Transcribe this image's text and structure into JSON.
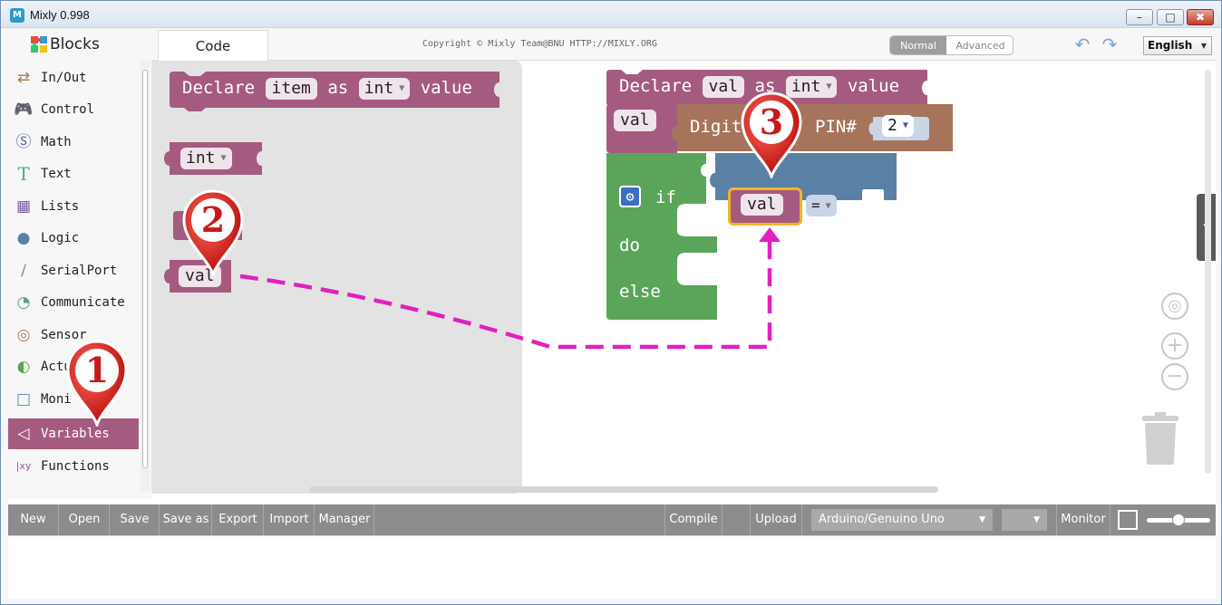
{
  "window": {
    "title": "Mixly 0.998",
    "min_icon": "–",
    "max_icon": "□",
    "close_icon": "✖"
  },
  "tabs": {
    "blocks": "Blocks",
    "code": "Code"
  },
  "copyright": "Copyright © Mixly Team@BNU HTTP://MIXLY.ORG",
  "mode": {
    "normal": "Normal",
    "advanced": "Advanced"
  },
  "language": "English",
  "categories": [
    {
      "label": "In/Out",
      "icon": "arrows-icon",
      "color": "#a0522d"
    },
    {
      "label": "Control",
      "icon": "gamepad-icon",
      "color": "#5ba55b"
    },
    {
      "label": "Math",
      "icon": "math-icon",
      "color": "#5b67a5"
    },
    {
      "label": "Text",
      "icon": "text-icon",
      "color": "#5ba58c"
    },
    {
      "label": "Lists",
      "icon": "lists-icon",
      "color": "#745ba5"
    },
    {
      "label": "Logic",
      "icon": "bulb-icon",
      "color": "#5b80a5"
    },
    {
      "label": "SerialPort",
      "icon": "plug-icon",
      "color": "#7ba05b"
    },
    {
      "label": "Communicate",
      "icon": "satellite-icon",
      "color": "#5b9e8c"
    },
    {
      "label": "Sensor",
      "icon": "sensor-icon",
      "color": "#a5805b"
    },
    {
      "label": "Actu",
      "icon": "actuator-icon",
      "color": "#5ba55b"
    },
    {
      "label": "Moni",
      "icon": "monitor-icon",
      "color": "#5b8ca5"
    },
    {
      "label": "Variables",
      "icon": "variables-icon",
      "color": "#a55b80",
      "selected": true
    },
    {
      "label": "Functions",
      "icon": "functions-icon",
      "color": "#995ba5"
    }
  ],
  "flyout": {
    "declare": {
      "declare": "Declare",
      "name": "item",
      "as": "as",
      "type": "int",
      "value": "value"
    },
    "type_block": "int",
    "getter": "val"
  },
  "canvas": {
    "declare": {
      "declare": "Declare",
      "name": "val",
      "as": "as",
      "type": "int",
      "value": "value"
    },
    "setter": {
      "var": "val",
      "func": "Digita",
      "pin_label": "PIN#",
      "pin": "2"
    },
    "ifelse": {
      "if": "if",
      "do": "do",
      "else": "else"
    },
    "compare": {
      "var": "val",
      "op": "="
    }
  },
  "markers": {
    "one": "1",
    "two": "2",
    "three": "3"
  },
  "bottom": {
    "new": "New",
    "open": "Open",
    "save": "Save",
    "save_as": "Save as",
    "export": "Export",
    "import": "Import",
    "manager": "Manager",
    "compile": "Compile",
    "upload": "Upload",
    "board": "Arduino/Genuino Uno",
    "monitor": "Monitor"
  },
  "colors": {
    "variables": "#a55b80",
    "control": "#5ba55b",
    "logic": "#5b80a5",
    "inout": "#a5745b",
    "marker": "#d01515",
    "arrow": "#e020c0"
  }
}
